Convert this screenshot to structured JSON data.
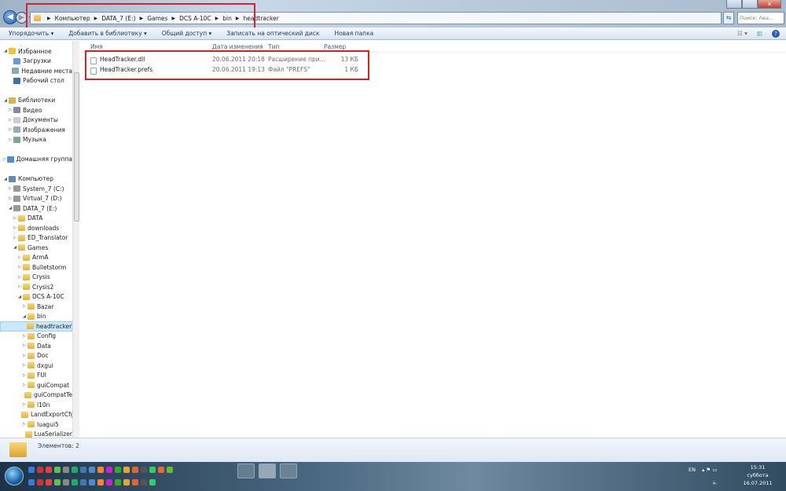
{
  "window": {
    "close_glyph": "x",
    "minimize_glyph": "–",
    "maximize_glyph": "▢"
  },
  "address": {
    "crumbs": [
      "Компьютер",
      "DATA_7 (E:)",
      "Games",
      "DCS A-10C",
      "bin",
      "headtracker"
    ],
    "search_placeholder": "Поиск: hea..."
  },
  "toolbar": {
    "organize": "Упорядочить ▾",
    "add_library": "Добавить в библиотеку ▾",
    "share": "Общий доступ ▾",
    "burn": "Записать на оптический диск",
    "new_folder": "Новая папка"
  },
  "sidebar": {
    "groups": [
      [
        {
          "label": "Избранное",
          "level": 0,
          "arrow": "open",
          "icon": "star"
        },
        {
          "label": "Загрузки",
          "level": 1,
          "icon": "downloads"
        },
        {
          "label": "Недавние места",
          "level": 1,
          "icon": "recent"
        },
        {
          "label": "Рабочий стол",
          "level": 1,
          "icon": "desktop"
        }
      ],
      [
        {
          "label": "Библиотеки",
          "level": 0,
          "arrow": "open",
          "icon": "library"
        },
        {
          "label": "Видео",
          "level": 1,
          "arrow": "closed",
          "icon": "video"
        },
        {
          "label": "Документы",
          "level": 1,
          "arrow": "closed",
          "icon": "docs"
        },
        {
          "label": "Изображения",
          "level": 1,
          "arrow": "closed",
          "icon": "images"
        },
        {
          "label": "Музыка",
          "level": 1,
          "arrow": "closed",
          "icon": "music"
        }
      ],
      [
        {
          "label": "Домашняя группа",
          "level": 0,
          "arrow": "closed",
          "icon": "homegroup"
        }
      ],
      [
        {
          "label": "Компьютер",
          "level": 0,
          "arrow": "open",
          "icon": "computer"
        },
        {
          "label": "System_7 (C:)",
          "level": 1,
          "arrow": "closed",
          "icon": "drive"
        },
        {
          "label": "Virtual_7 (D:)",
          "level": 1,
          "arrow": "closed",
          "icon": "drive"
        },
        {
          "label": "DATA_7 (E:)",
          "level": 1,
          "arrow": "open",
          "icon": "drive"
        },
        {
          "label": "DATA",
          "level": 2,
          "arrow": "closed",
          "icon": "folder"
        },
        {
          "label": "downloads",
          "level": 2,
          "arrow": "closed",
          "icon": "folder"
        },
        {
          "label": "ED_Translator",
          "level": 2,
          "arrow": "closed",
          "icon": "folder"
        },
        {
          "label": "Games",
          "level": 2,
          "arrow": "open",
          "icon": "folder"
        },
        {
          "label": "ArmA",
          "level": 3,
          "arrow": "closed",
          "icon": "folder"
        },
        {
          "label": "Bulletstorm",
          "level": 3,
          "arrow": "closed",
          "icon": "folder"
        },
        {
          "label": "Crysis",
          "level": 3,
          "arrow": "closed",
          "icon": "folder"
        },
        {
          "label": "Crysis2",
          "level": 3,
          "arrow": "closed",
          "icon": "folder"
        },
        {
          "label": "DCS A-10C",
          "level": 3,
          "arrow": "open",
          "icon": "folder"
        },
        {
          "label": "Bazar",
          "level": 4,
          "arrow": "closed",
          "icon": "folder"
        },
        {
          "label": "bin",
          "level": 4,
          "arrow": "open",
          "icon": "folder"
        },
        {
          "label": "headtracker",
          "level": 5,
          "icon": "folder",
          "selected": true
        },
        {
          "label": "Config",
          "level": 4,
          "arrow": "closed",
          "icon": "folder"
        },
        {
          "label": "Data",
          "level": 4,
          "arrow": "closed",
          "icon": "folder"
        },
        {
          "label": "Doc",
          "level": 4,
          "arrow": "closed",
          "icon": "folder"
        },
        {
          "label": "dxgui",
          "level": 4,
          "arrow": "closed",
          "icon": "folder"
        },
        {
          "label": "FUI",
          "level": 4,
          "arrow": "closed",
          "icon": "folder"
        },
        {
          "label": "guiCompat",
          "level": 4,
          "arrow": "closed",
          "icon": "folder"
        },
        {
          "label": "guiCompatTe",
          "level": 4,
          "icon": "folder"
        },
        {
          "label": "l10n",
          "level": 4,
          "arrow": "closed",
          "icon": "folder"
        },
        {
          "label": "LandExportCfg",
          "level": 4,
          "icon": "folder"
        },
        {
          "label": "luagui5",
          "level": 4,
          "arrow": "closed",
          "icon": "folder"
        },
        {
          "label": "LuaSerializer",
          "level": 4,
          "icon": "folder"
        }
      ]
    ]
  },
  "columns": {
    "name": "Имя",
    "date": "Дата изменения",
    "type": "Тип",
    "size": "Размер"
  },
  "files": [
    {
      "name": "HeadTracker.dll",
      "date": "20.06.2011 20:18",
      "type": "Расширение при...",
      "size": "13 КБ",
      "icon": "dll"
    },
    {
      "name": "HeadTracker.prefs",
      "date": "20.06.2011 19:13",
      "type": "Файл \"PREFS\"",
      "size": "1 КБ",
      "icon": "file"
    }
  ],
  "status": {
    "items": "Элементов: 2"
  },
  "taskbar": {
    "lang": "EN",
    "time": "15:31",
    "day": "суббота",
    "date": "16.07.2011"
  },
  "colors": {
    "highlight": "#d8202c",
    "selection": "#cce8ff"
  }
}
